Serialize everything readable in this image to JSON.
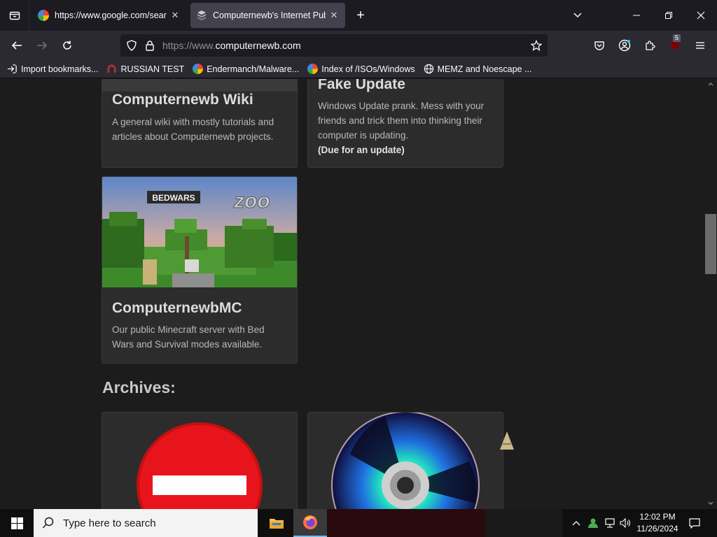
{
  "browser": {
    "tabs": [
      {
        "title": "https://www.google.com/searc",
        "close": "✕"
      },
      {
        "title": "Computernewb's Internet Pub |",
        "close": "✕"
      }
    ],
    "new_tab": "+",
    "url_prefix": "https://www.",
    "url_domain": "computernewb.com",
    "extension_badge": "5",
    "bookmarks": [
      {
        "label": "Import bookmarks..."
      },
      {
        "label": "RUSSIAN TEST"
      },
      {
        "label": "Endermanch/Malware..."
      },
      {
        "label": "Index of /ISOs/Windows"
      },
      {
        "label": "MEMZ and Noescape ..."
      }
    ]
  },
  "page": {
    "cards": [
      {
        "title": "Computernewb Wiki",
        "description": "A general wiki with mostly tutorials and articles about Computernewb projects."
      },
      {
        "title": "Fake Update",
        "description": "Windows Update prank. Mess with your friends and trick them into thinking their computer is updating.",
        "note": "(Due for an update)"
      },
      {
        "title": "ComputernewbMC",
        "description": "Our public Minecraft server with Bed Wars and Survival modes available.",
        "image_sign": "BEDWARS",
        "image_text": "zoo"
      }
    ],
    "archives_heading": "Archives:"
  },
  "taskbar": {
    "search_placeholder": "Type here to search",
    "time": "12:02 PM",
    "date": "11/26/2024"
  },
  "colors": {
    "accent_tab": "#42414d",
    "page_bg": "#1c1c1c",
    "card_bg": "#2c2c2c",
    "stop_sign": "#e8141c"
  }
}
